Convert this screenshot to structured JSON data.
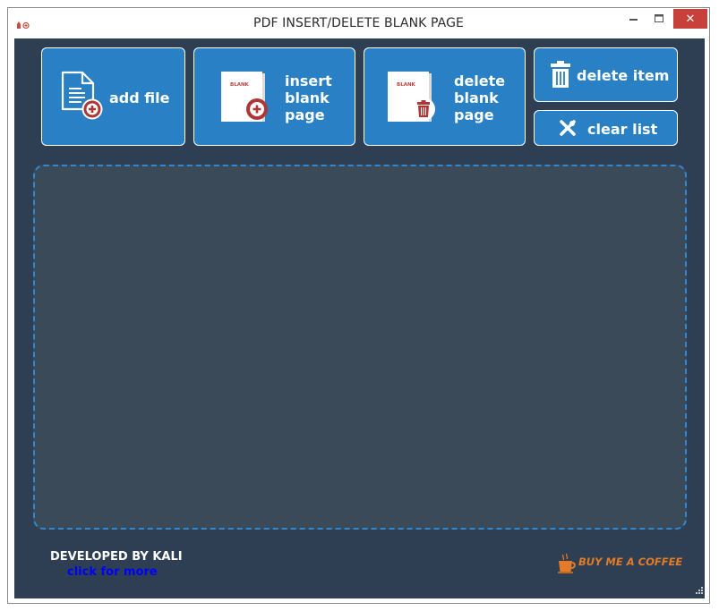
{
  "window": {
    "title": "PDF INSERT/DELETE BLANK PAGE",
    "close_glyph": "✕"
  },
  "toolbar": {
    "add_file_label": "add file",
    "insert_blank_label": "insert\nblank\npage",
    "delete_blank_label": "delete\nblank\npage",
    "delete_item_label": "delete item",
    "clear_list_label": "clear list",
    "blank_page_text": "BLANK"
  },
  "footer": {
    "developer": "DEVELOPED BY KALI",
    "link": "click for more",
    "coffee": "BUY ME A COFFEE"
  },
  "colors": {
    "background": "#2e3f53",
    "button": "#2980c4",
    "dropzone": "#3a4a59",
    "dropzone_border": "#2f88d2",
    "icon_red": "#b03535",
    "close_red": "#c7403a",
    "link_blue": "#0000ff",
    "coffee_orange": "#e37b28"
  },
  "icons": {
    "add_file": "document-add-icon",
    "insert_blank": "blank-page-add-icon",
    "delete_blank": "blank-page-trash-icon",
    "delete_item": "trash-icon",
    "clear_list": "cross-tools-icon",
    "coffee": "coffee-cup-icon"
  }
}
